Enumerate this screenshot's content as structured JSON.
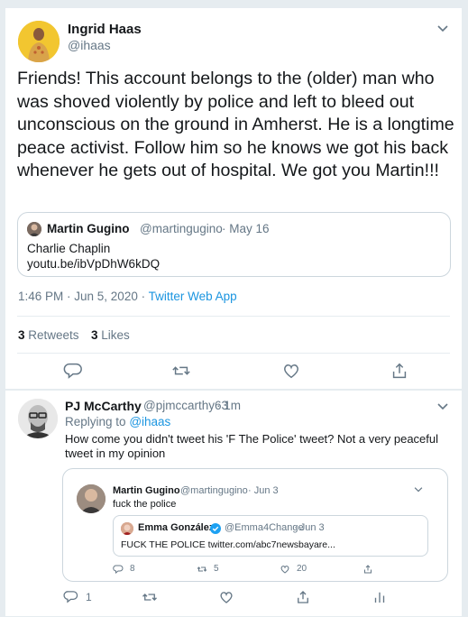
{
  "main_tweet": {
    "author_name": "Ingrid Haas",
    "author_handle": "@ihaas",
    "text": "Friends! This account belongs to the (older) man who was shoved violently by police and left to bleed out unconscious on the ground in Amherst. He is a longtime peace activist. Follow him so he knows we got his back whenever he gets out of hospital. We got you Martin!!!",
    "quoted": {
      "author_name": "Martin Gugino",
      "author_handle": "@martingugino",
      "date": "· May 16",
      "text": "Charlie Chaplin",
      "link": "youtu.be/ibVpDhW6kDQ"
    },
    "time": "1:46 PM · Jun 5, 2020",
    "separator": " · ",
    "client": "Twitter Web App",
    "retweets_count": "3",
    "retweets_label": "Retweets",
    "likes_count": "3",
    "likes_label": "Likes"
  },
  "reply_tweet": {
    "author_name": "PJ McCarthy",
    "author_handle": "@pjmccarthy63",
    "time": "· 1m",
    "replying_prefix": "Replying to",
    "replying_to": "@ihaas",
    "text": "How come you didn't tweet his 'F The Police' tweet?  Not a very peaceful tweet in my opinion",
    "quoted": {
      "author_name": "Martin Gugino",
      "author_handle": "@martingugino",
      "date": "· Jun 3",
      "text": "fuck the police",
      "nested": {
        "author_name": "Emma González",
        "author_handle": "@Emma4Change",
        "date": "· Jun 3",
        "text": "FUCK THE POLICE twitter.com/abc7newsbayare..."
      },
      "replies": "8",
      "retweets": "5",
      "likes": "20"
    },
    "reply_count": "1"
  },
  "colors": {
    "link_blue": "#1b95e0",
    "icon_gray": "#657786",
    "verified_blue": "#1da1f2",
    "border": "#ccd6dd"
  },
  "icons": {
    "reply": "reply-icon",
    "retweet": "retweet-icon",
    "like": "like-icon",
    "share": "share-icon",
    "analytics": "analytics-icon",
    "chevron": "chevron-down-icon",
    "verified": "verified-badge-icon"
  }
}
